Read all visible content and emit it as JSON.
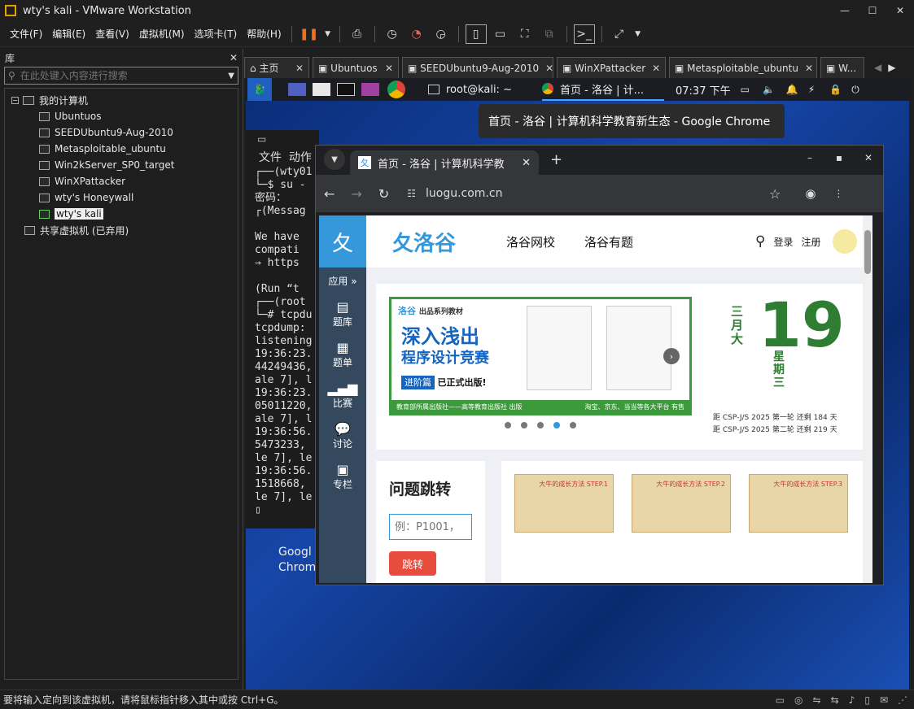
{
  "window": {
    "title": "wty's kali - VMware Workstation",
    "min": "—",
    "max": "☐",
    "close": "✕"
  },
  "menu": [
    "文件(F)",
    "编辑(E)",
    "查看(V)",
    "虚拟机(M)",
    "选项卡(T)",
    "帮助(H)"
  ],
  "library": {
    "title": "库",
    "close": "✕",
    "search_placeholder": "在此处键入内容进行搜索",
    "root": "我的计算机",
    "vms": [
      "Ubuntuos",
      "SEEDUbuntu9-Aug-2010",
      "Metasploitable_ubuntu",
      "Win2kServer_SP0_target",
      "WinXPattacker",
      "wty's Honeywall",
      "wty's kali"
    ],
    "shared": "共享虚拟机 (已弃用)"
  },
  "tabs": [
    {
      "label": "主页"
    },
    {
      "label": "Ubuntuos"
    },
    {
      "label": "SEEDUbuntu9-Aug-2010"
    },
    {
      "label": "WinXPattacker"
    },
    {
      "label": "Metasploitable_ubuntu"
    },
    {
      "label": "W..."
    }
  ],
  "kali": {
    "task_term": "root@kali: ~",
    "task_chrome": "首页 - 洛谷 | 计...",
    "clock": "07:37 下午",
    "tooltip": "首页 - 洛谷 | 计算机科学教育新生态 - Google Chrome",
    "desk_icon": "Googl Chrom"
  },
  "terminal": {
    "menu1": "文件",
    "menu2": "动作",
    "lines": [
      "┌──(wty01",
      "└─$ su -",
      "密码：",
      "┌(Messag",
      "",
      "We have",
      "compati",
      "⇒ https",
      "",
      "(Run “t",
      "┌──(root",
      "└─# tcpdu",
      "tcpdump:",
      "listening",
      "19:36:23.",
      "44249436,",
      "ale 7], l",
      "19:36:23.",
      "05011220,",
      "ale 7], l",
      "19:36:56.",
      "5473233,",
      "le 7], le",
      "19:36:56.",
      "1518668,",
      "le 7], le"
    ]
  },
  "chrome": {
    "tab_title": "首页 - 洛谷 | 计算机科学教",
    "url": "luogu.com.cn",
    "nav": [
      "洛谷网校",
      "洛谷有题"
    ],
    "login": "登录",
    "register": "注册",
    "logo": "洛谷",
    "sidebar": [
      "应用",
      "题库",
      "题单",
      "比赛",
      "讨论",
      "专栏"
    ],
    "banner": {
      "brand": "洛谷",
      "sub": "出品系列教材",
      "line1": "深入浅出",
      "line2": "程序设计竞赛",
      "tag": "进阶篇",
      "pub": "已正式出版!",
      "foot1": "教育部所属出版社——高等教育出版社 出版",
      "foot2": "淘宝、京东、当当等各大平台 有售"
    },
    "date": {
      "month": "三月大",
      "day": "19",
      "week": "星期三",
      "c1": "距 CSP-J/S 2025 第一轮 还剩 184 天",
      "c2": "距 CSP-J/S 2025 第二轮 还剩 219 天"
    },
    "jump": {
      "title": "问题跳转",
      "placeholder": "例：P1001，",
      "btn": "跳转"
    },
    "cards": [
      "大牛的成长方法 STEP.1",
      "大牛的成长方法 STEP.2",
      "大牛的成长方法 STEP.3"
    ]
  },
  "statusbar": "要将输入定向到该虚拟机，请将鼠标指针移入其中或按 Ctrl+G。",
  "colors": {
    "luogu_blue": "#3498db",
    "green": "#2e7d32",
    "red": "#e74c3c"
  }
}
